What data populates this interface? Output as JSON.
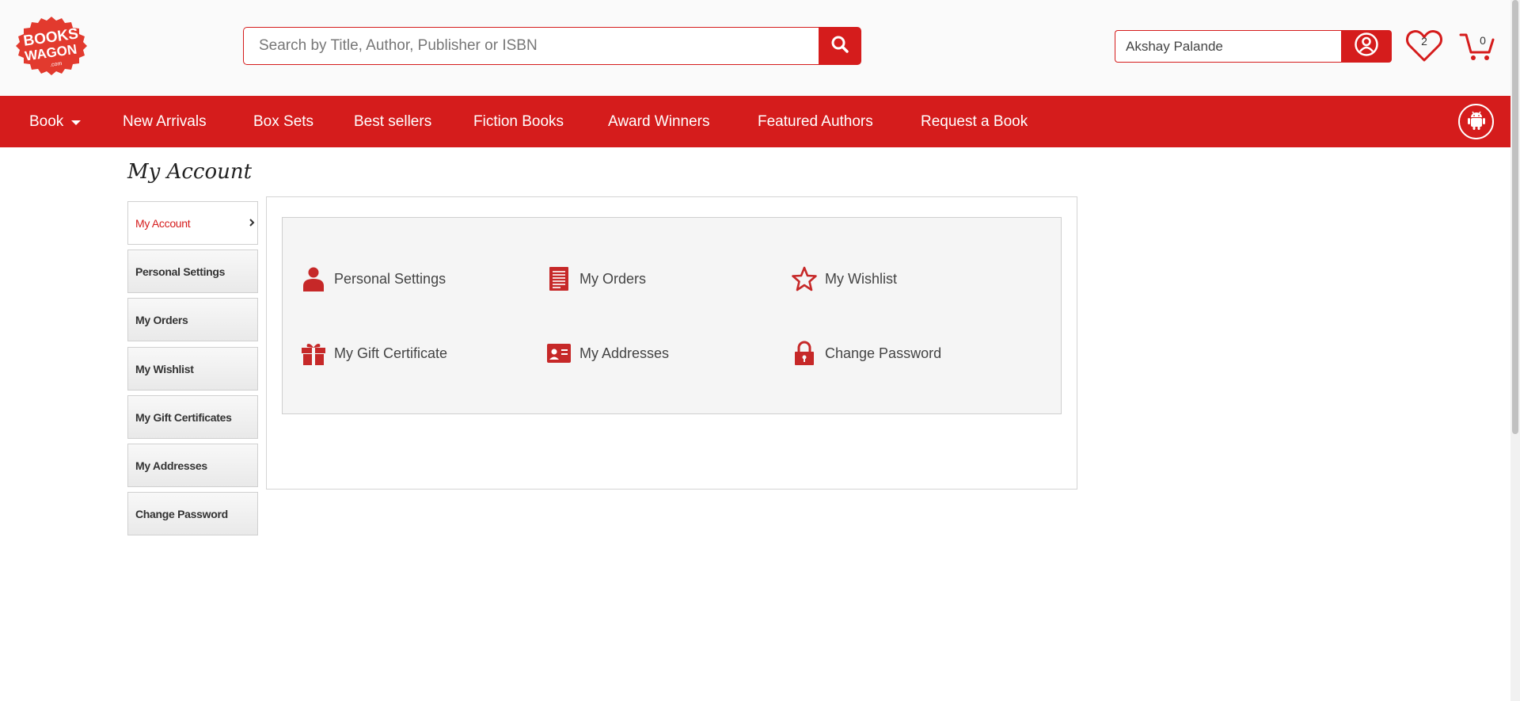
{
  "header": {
    "logo_text": "BOOKS WAGON .com",
    "search_placeholder": "Search by Title, Author, Publisher or ISBN",
    "user_name": "Akshay Palande",
    "wishlist_count": "2",
    "cart_count": "0"
  },
  "nav": {
    "items": [
      {
        "label": "Book"
      },
      {
        "label": "New Arrivals"
      },
      {
        "label": "Box Sets"
      },
      {
        "label": "Best sellers"
      },
      {
        "label": "Fiction Books"
      },
      {
        "label": "Award Winners"
      },
      {
        "label": "Featured Authors"
      },
      {
        "label": "Request a Book"
      }
    ]
  },
  "page": {
    "title": "My Account"
  },
  "sidebar": {
    "items": [
      {
        "label": "My Account"
      },
      {
        "label": "Personal Settings"
      },
      {
        "label": "My Orders"
      },
      {
        "label": "My Wishlist"
      },
      {
        "label": "My Gift Certificates"
      },
      {
        "label": "My Addresses"
      },
      {
        "label": "Change Password"
      }
    ]
  },
  "tiles": [
    {
      "label": "Personal Settings",
      "icon": "user-icon"
    },
    {
      "label": "My Orders",
      "icon": "document-icon"
    },
    {
      "label": "My Wishlist",
      "icon": "star-icon"
    },
    {
      "label": "My Gift Certificate",
      "icon": "gift-icon"
    },
    {
      "label": "My Addresses",
      "icon": "id-card-icon"
    },
    {
      "label": "Change Password",
      "icon": "lock-icon"
    }
  ],
  "colors": {
    "brand_red": "#d51c1c",
    "header_bg": "#fafafa"
  }
}
